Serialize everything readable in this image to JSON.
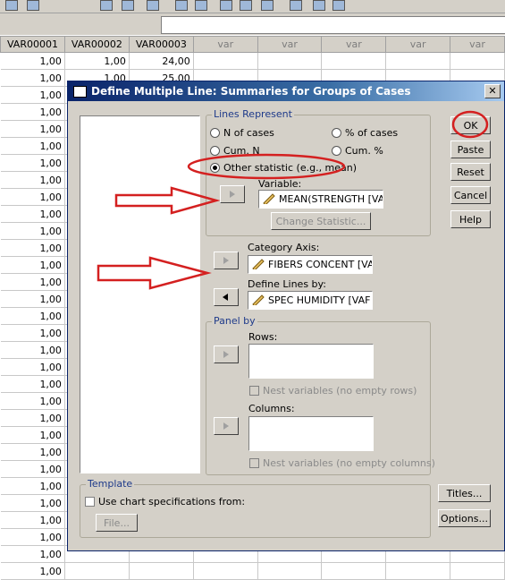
{
  "spreadsheet": {
    "columns": [
      "VAR00001",
      "VAR00002",
      "VAR00003",
      "var",
      "var",
      "var",
      "var",
      "var"
    ],
    "rows": [
      [
        "1,00",
        "1,00",
        "24,00"
      ],
      [
        "1,00",
        "1,00",
        "25,00"
      ],
      [
        "1,00",
        "",
        ""
      ],
      [
        "1,00",
        "",
        ""
      ],
      [
        "1,00",
        "",
        ""
      ],
      [
        "1,00",
        "",
        ""
      ],
      [
        "1,00",
        "",
        ""
      ],
      [
        "1,00",
        "",
        ""
      ],
      [
        "1,00",
        "",
        ""
      ],
      [
        "1,00",
        "",
        ""
      ],
      [
        "1,00",
        "",
        ""
      ],
      [
        "1,00",
        "",
        ""
      ],
      [
        "1,00",
        "",
        ""
      ],
      [
        "1,00",
        "",
        ""
      ],
      [
        "1,00",
        "",
        ""
      ],
      [
        "1,00",
        "",
        ""
      ],
      [
        "1,00",
        "",
        ""
      ],
      [
        "1,00",
        "",
        ""
      ],
      [
        "1,00",
        "",
        ""
      ],
      [
        "1,00",
        "",
        ""
      ],
      [
        "1,00",
        "",
        ""
      ],
      [
        "1,00",
        "",
        ""
      ],
      [
        "1,00",
        "",
        ""
      ],
      [
        "1,00",
        "",
        ""
      ],
      [
        "1,00",
        "",
        ""
      ],
      [
        "1,00",
        "",
        ""
      ],
      [
        "1,00",
        "",
        ""
      ],
      [
        "1,00",
        "",
        ""
      ],
      [
        "1,00",
        "",
        ""
      ],
      [
        "1,00",
        "",
        ""
      ],
      [
        "1,00",
        "",
        ""
      ]
    ]
  },
  "dialog": {
    "title": "Define Multiple Line: Summaries for Groups of Cases",
    "close_label": "✕",
    "lines_represent": {
      "label": "Lines Represent",
      "n_of_cases": "N of cases",
      "pct_of_cases": "% of cases",
      "cum_n": "Cum. N",
      "cum_pct": "Cum. %",
      "other_statistic": "Other statistic (e.g., mean)",
      "variable_label": "Variable:",
      "variable_value": "MEAN(STRENGTH [VA",
      "change_statistic": "Change Statistic..."
    },
    "category_axis": {
      "label": "Category Axis:",
      "value": "FIBERS CONCENT [VA"
    },
    "define_lines": {
      "label": "Define Lines by:",
      "value": "SPEC HUMIDITY  [VAF"
    },
    "panel_by": {
      "label": "Panel by",
      "rows_label": "Rows:",
      "nest_rows": "Nest variables (no empty rows)",
      "columns_label": "Columns:",
      "nest_columns": "Nest variables (no empty columns)"
    },
    "template": {
      "label": "Template",
      "use_chart_spec": "Use chart specifications from:",
      "file_button": "File..."
    },
    "buttons": {
      "ok": "OK",
      "paste": "Paste",
      "reset": "Reset",
      "cancel": "Cancel",
      "help": "Help",
      "titles": "Titles...",
      "options": "Options..."
    }
  },
  "colors": {
    "annotation": "#d42020",
    "title_bar": "#0a246a",
    "dialog_bg": "#d4d0c8"
  }
}
